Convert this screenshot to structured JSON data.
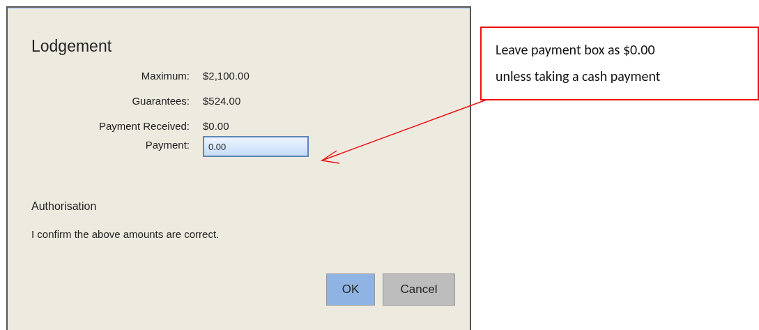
{
  "dialog": {
    "title": "Lodgement",
    "fields": [
      {
        "label": "Maximum:",
        "value": "$2,100.00",
        "kind": "text"
      },
      {
        "label": "Guarantees:",
        "value": "$524.00",
        "kind": "text"
      },
      {
        "label": "Payment Received:",
        "value": "$0.00",
        "kind": "text"
      },
      {
        "label": "Payment:",
        "value": "0.00",
        "kind": "input"
      }
    ],
    "section_title": "Authorisation",
    "confirmation": "I confirm the above amounts are correct.",
    "buttons": [
      {
        "label": "OK",
        "kind": "primary"
      },
      {
        "label": "Cancel",
        "kind": "secondary"
      }
    ]
  },
  "callout": {
    "lines": [
      "Leave payment box as $0.00",
      "unless taking a cash payment"
    ]
  }
}
